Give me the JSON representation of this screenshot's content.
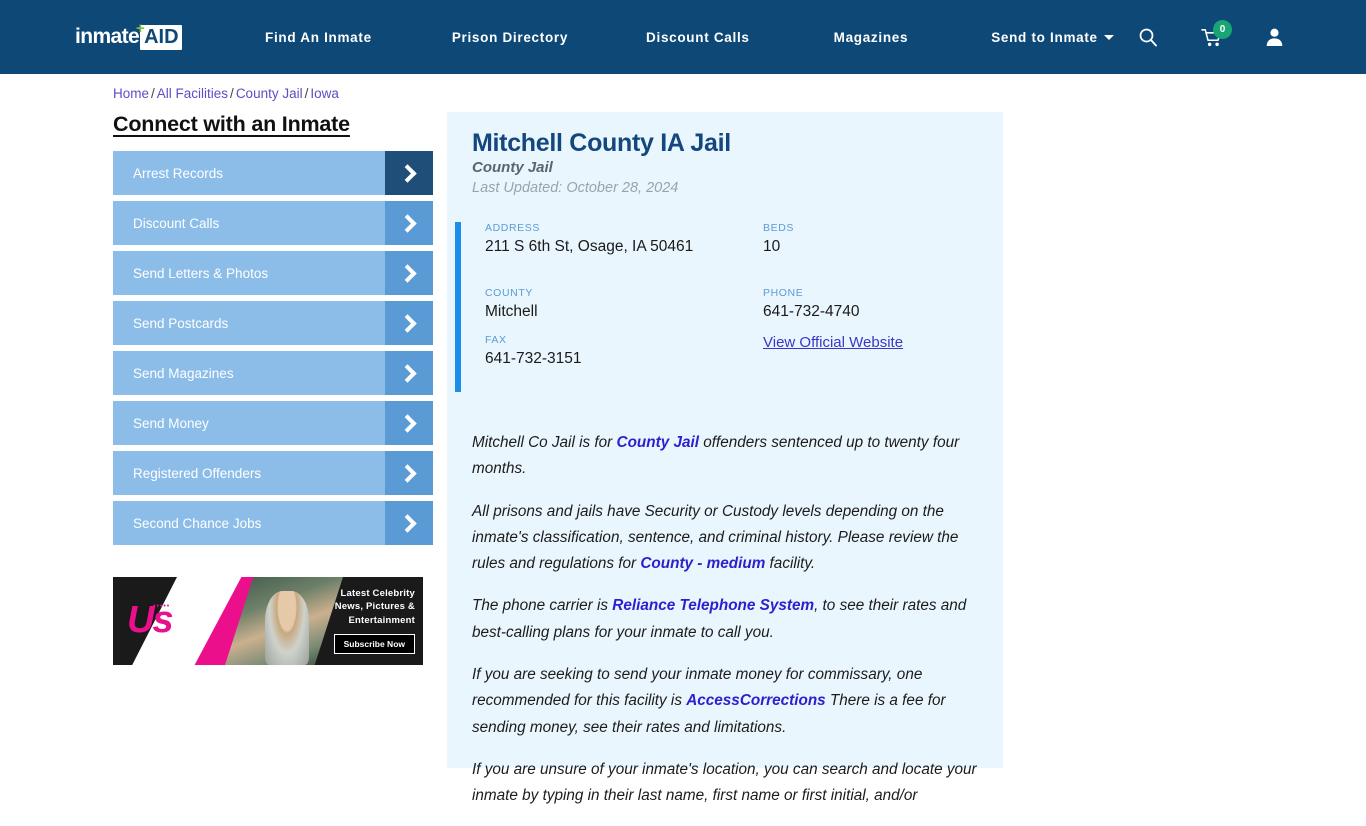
{
  "header": {
    "logo": {
      "text_primary": "inmate",
      "text_badge": "AID",
      "plus_glyph": "+"
    },
    "nav_items": [
      {
        "label": "Find An Inmate",
        "has_dropdown": false
      },
      {
        "label": "Prison Directory",
        "has_dropdown": false
      },
      {
        "label": "Discount Calls",
        "has_dropdown": false
      },
      {
        "label": "Magazines",
        "has_dropdown": false
      },
      {
        "label": "Send to Inmate",
        "has_dropdown": true
      }
    ],
    "icons": {
      "search": "search-icon",
      "cart": "cart-icon",
      "cart_badge_count": "0",
      "account": "user-icon"
    },
    "colors": {
      "bar_background": "#0d4877",
      "badge_green": "#17a673"
    }
  },
  "breadcrumb": {
    "items": [
      "Home",
      "All Facilities",
      "County Jail",
      "Iowa"
    ],
    "separator": "/"
  },
  "sidebar": {
    "heading": "Connect with an Inmate",
    "items": [
      {
        "label": "Arrest Records",
        "active": true
      },
      {
        "label": "Discount Calls",
        "active": false
      },
      {
        "label": "Send Letters & Photos",
        "active": false
      },
      {
        "label": "Send Postcards",
        "active": false
      },
      {
        "label": "Send Magazines",
        "active": false
      },
      {
        "label": "Send Money",
        "active": false
      },
      {
        "label": "Registered Offenders",
        "active": false
      },
      {
        "label": "Second Chance Jobs",
        "active": false
      }
    ],
    "colors": {
      "button": "#8bbde8",
      "arrow": "#5b9bd5",
      "arrow_active": "#1f4e79"
    }
  },
  "ad": {
    "brand": "Us",
    "tagline_line1": "Latest Celebrity",
    "tagline_line2": "News, Pictures &",
    "tagline_line3": "Entertainment",
    "cta_label": "Subscribe Now",
    "accent_color": "#ec0f8c"
  },
  "facility": {
    "title": "Mitchell County IA Jail",
    "subtitle": "County Jail",
    "last_updated": "Last Updated: October 28, 2024",
    "fields": {
      "address_label": "ADDRESS",
      "address_value": "211 S 6th St, Osage, IA 50461",
      "beds_label": "BEDS",
      "beds_value": "10",
      "county_label": "COUNTY",
      "county_value": "Mitchell",
      "phone_label": "PHONE",
      "phone_value": "641-732-4740",
      "fax_label": "FAX",
      "fax_value": "641-732-3151",
      "website_link": "View Official Website"
    },
    "accent_bar_color": "#1c8ee8",
    "panel_background": "#eaf6fd"
  },
  "body": {
    "p1_part1": "Mitchell Co Jail is for ",
    "p1_bold": "County Jail",
    "p1_part2": " offenders sentenced up to twenty four months.",
    "p2_part1": "All prisons and jails have Security or Custody levels depending on the inmate's classification, sentence, and criminal history. Please review the rules and regulations for ",
    "p2_bold": "County - medium",
    "p2_part2": " facility.",
    "p3_part1": "The phone carrier is ",
    "p3_bold": "Reliance Telephone System",
    "p3_part2": ", to see their rates and best-calling plans for your inmate to call you.",
    "p4_part1": "If you are seeking to send your inmate money for commissary, one recommended for this facility is ",
    "p4_bold": "AccessCorrections",
    "p4_part2": " There is a fee for sending money, see their rates and limitations.",
    "p5_part1": "If you are unsure of your inmate's location, you can search and locate your inmate by typing in their last name, first name or first initial, and/or",
    "p5_bold": "",
    "p5_part2": ""
  }
}
